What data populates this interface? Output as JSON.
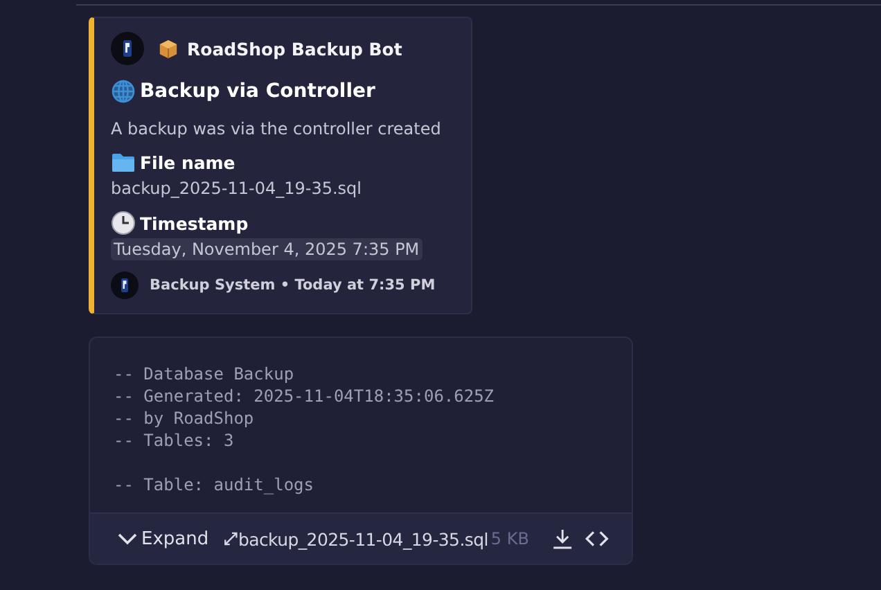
{
  "embed": {
    "author": {
      "name": "RoadShop Backup Bot"
    },
    "title": "Backup via Controller",
    "description": "A backup was via the controller created",
    "fields": [
      {
        "kind": "file",
        "name": "File name",
        "value": "backup_2025-11-04_19-35.sql"
      },
      {
        "kind": "time",
        "name": "Timestamp",
        "value": "Tuesday, November 4, 2025 7:35 PM"
      }
    ],
    "footer": {
      "text": "Backup System • Today at 7:35 PM"
    }
  },
  "attachment": {
    "code_paragraphs": [
      [
        "-- Database Backup",
        "-- Generated: 2025-11-04T18:35:06.625Z",
        "-- by RoadShop",
        "-- Tables: 3"
      ],
      [
        "-- Table: audit_logs"
      ]
    ],
    "expand_label": "Expand",
    "file_name": "backup_2025-11-04_19-35.sql",
    "size": "5 KB"
  }
}
